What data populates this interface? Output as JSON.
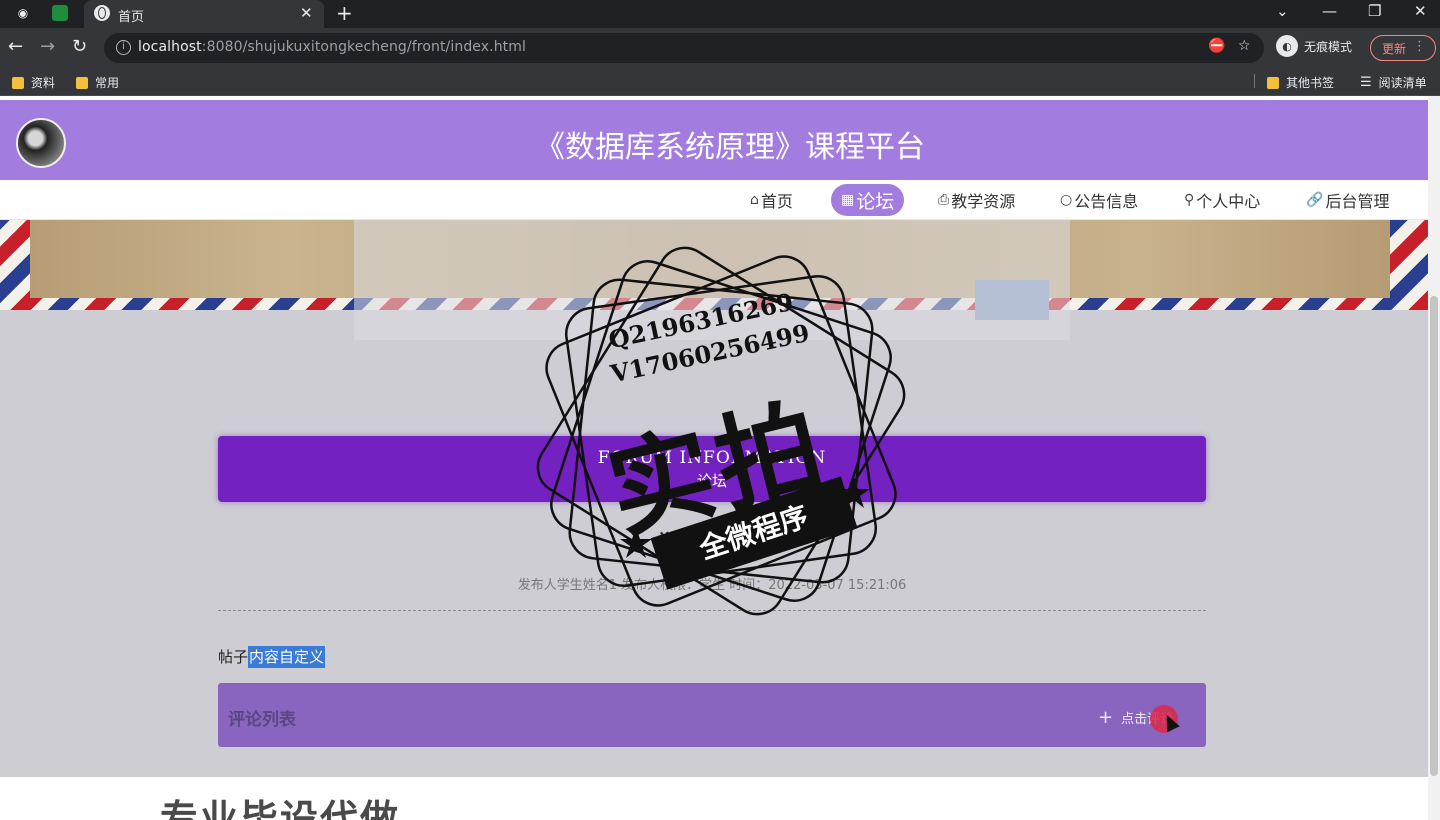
{
  "browser": {
    "tab_title": "首页",
    "url_host": "localhost",
    "url_rest": ":8080/shujukuxitongkecheng/front/index.html",
    "incognito_label": "无痕模式",
    "update_label": "更新",
    "bookmarks": [
      "资料",
      "常用"
    ],
    "bookmarks_right": [
      "其他书签",
      "阅读清单"
    ]
  },
  "site": {
    "title": "《数据库系统原理》课程平台",
    "menu": [
      {
        "label": "首页",
        "icon": "home-icon"
      },
      {
        "label": "论坛",
        "icon": "forum-icon"
      },
      {
        "label": "教学资源",
        "icon": "printer-icon"
      },
      {
        "label": "公告信息",
        "icon": "circle-icon"
      },
      {
        "label": "个人中心",
        "icon": "user-icon"
      },
      {
        "label": "后台管理",
        "icon": "link-icon"
      }
    ],
    "active_menu": "论坛"
  },
  "forum": {
    "heading_en": "FORUM INFORMATION",
    "heading_cn": "论坛"
  },
  "post": {
    "title": "学生发帖子",
    "meta": "发布人学生姓名1    发布人权限：学生    时间：2022-03-07 15:21:06",
    "content_prefix": "帖子",
    "content_selected": "内容自定义"
  },
  "comments": {
    "title": "评论列表",
    "add_label": "点击评论"
  },
  "footer": {
    "text": "专业毕设代做"
  },
  "watermark": {
    "line1": "Q2196316269",
    "line2": "V17060256499",
    "big": "实拍",
    "ribbon": "全微程序"
  },
  "colors": {
    "header": "#a37ce0",
    "forum_banner": "#7321c0",
    "comment_bar": "#8965c0"
  }
}
